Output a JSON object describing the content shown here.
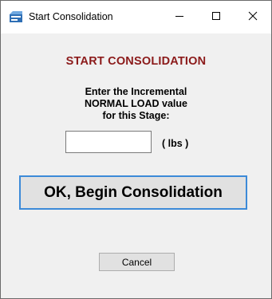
{
  "window": {
    "title": "Start Consolidation",
    "icon": "app-icon",
    "controls": {
      "minimize_icon": "minimize-icon",
      "maximize_icon": "maximize-icon",
      "close_icon": "close-icon"
    }
  },
  "dialog": {
    "heading": "START CONSOLIDATION",
    "prompt_lines": [
      "Enter the Incremental",
      "NORMAL LOAD value",
      "for this Stage:"
    ],
    "load_input": {
      "value": "",
      "placeholder": ""
    },
    "units": "( lbs )",
    "ok_button": "OK, Begin Consolidation",
    "cancel_button": "Cancel"
  },
  "colors": {
    "heading": "#8b1a1a",
    "ok_border": "#3c8ad8",
    "button_face": "#e1e1e1",
    "client_bg": "#f0f0f0"
  }
}
